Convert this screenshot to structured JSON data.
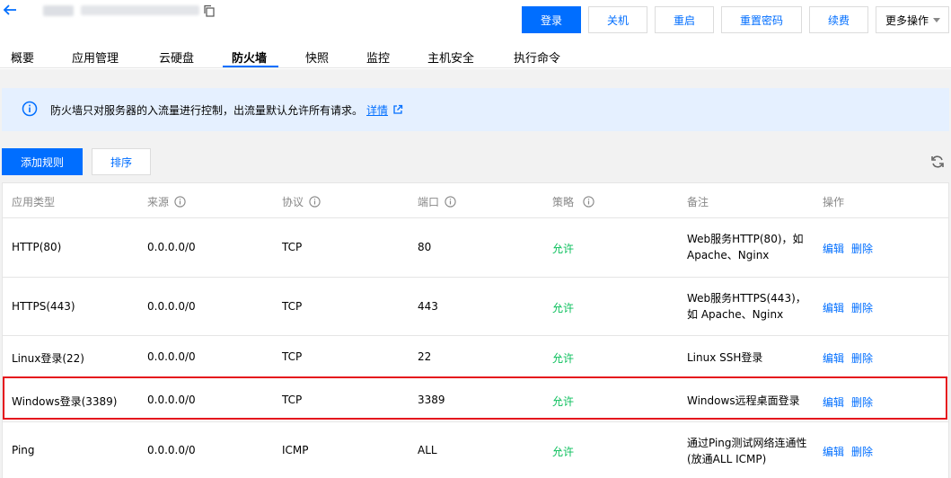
{
  "header": {
    "buttons": {
      "login": "登录",
      "shutdown": "关机",
      "restart": "重启",
      "reset_password": "重置密码",
      "renew": "续费",
      "more": "更多操作"
    }
  },
  "tabs": [
    "概要",
    "应用管理",
    "云硬盘",
    "防火墙",
    "快照",
    "监控",
    "主机安全",
    "执行命令"
  ],
  "active_tab": "防火墙",
  "notice": {
    "text": "防火墙只对服务器的入流量进行控制，出流量默认允许所有请求。",
    "link": "详情"
  },
  "toolbar": {
    "add_rule": "添加规则",
    "sort": "排序"
  },
  "table": {
    "headers": {
      "app_type": "应用类型",
      "source": "来源",
      "protocol": "协议",
      "port": "端口",
      "policy": "策略",
      "note": "备注",
      "actions": "操作"
    },
    "action_labels": {
      "edit": "编辑",
      "delete": "删除"
    },
    "rows": [
      {
        "app_type": "HTTP(80)",
        "source": "0.0.0.0/0",
        "protocol": "TCP",
        "port": "80",
        "policy": "允许",
        "note": "Web服务HTTP(80)，如Apache、Nginx"
      },
      {
        "app_type": "HTTPS(443)",
        "source": "0.0.0.0/0",
        "protocol": "TCP",
        "port": "443",
        "policy": "允许",
        "note": "Web服务HTTPS(443)，如 Apache、Nginx"
      },
      {
        "app_type": "Linux登录(22)",
        "source": "0.0.0.0/0",
        "protocol": "TCP",
        "port": "22",
        "policy": "允许",
        "note": "Linux SSH登录"
      },
      {
        "app_type": "Windows登录(3389)",
        "source": "0.0.0.0/0",
        "protocol": "TCP",
        "port": "3389",
        "policy": "允许",
        "note": "Windows远程桌面登录"
      },
      {
        "app_type": "Ping",
        "source": "0.0.0.0/0",
        "protocol": "ICMP",
        "port": "ALL",
        "policy": "允许",
        "note": "通过Ping测试网络连通性(放通ALL ICMP)"
      }
    ]
  },
  "colors": {
    "primary": "#006eff",
    "allow": "#0abf5b",
    "highlight": "#e5151d",
    "notice_bg": "#e5f0ff"
  },
  "icons": [
    "back-arrow-icon",
    "copy-icon",
    "info-icon",
    "external-link-icon",
    "refresh-icon",
    "caret-down-icon"
  ]
}
